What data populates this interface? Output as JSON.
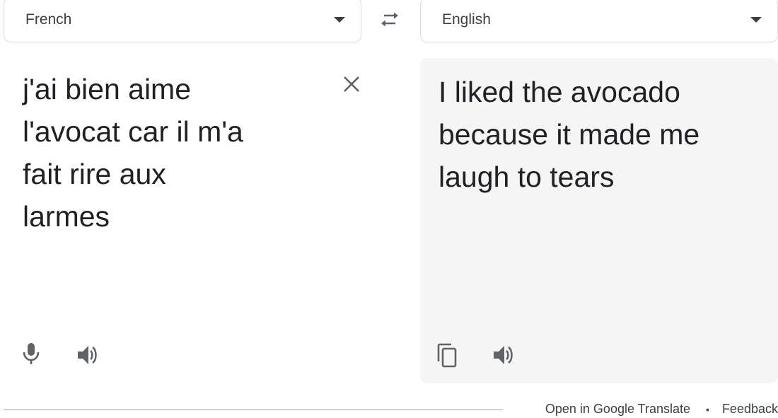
{
  "source_language": {
    "label": "French"
  },
  "target_language": {
    "label": "English"
  },
  "swap": {
    "icon": "swap-languages-icon"
  },
  "source_text": "j'ai bien aime\nl'avocat car il m'a\nfait rire aux\nlarmes",
  "translated_text": "I liked the avocado because it made me laugh to tears",
  "icons": {
    "clear": "close-icon",
    "mic": "microphone-icon",
    "listen": "speaker-icon",
    "copy": "copy-icon"
  },
  "footer": {
    "open_link": "Open in Google Translate",
    "separator": "•",
    "feedback_link": "Feedback"
  },
  "colors": {
    "icon": "#5f6368",
    "target_background": "#f5f5f5",
    "border": "#dadce0"
  }
}
